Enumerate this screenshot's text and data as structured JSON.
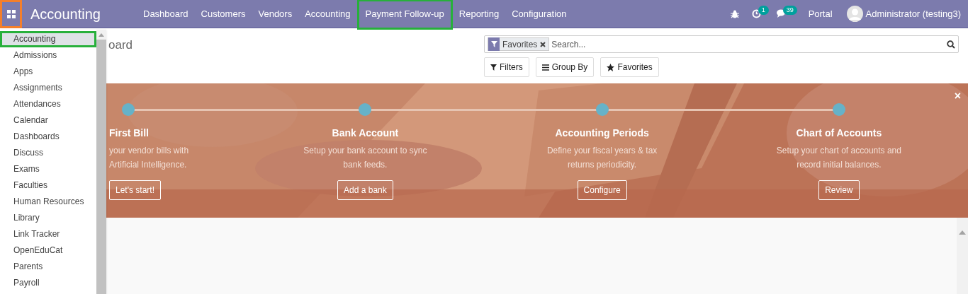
{
  "navbar": {
    "app_title": "Accounting",
    "menu": [
      {
        "label": "Dashboard",
        "highlighted": false
      },
      {
        "label": "Customers",
        "highlighted": false
      },
      {
        "label": "Vendors",
        "highlighted": false
      },
      {
        "label": "Accounting",
        "highlighted": false
      },
      {
        "label": "Payment Follow-up",
        "highlighted": true
      },
      {
        "label": "Reporting",
        "highlighted": false
      },
      {
        "label": "Configuration",
        "highlighted": false
      }
    ],
    "activity_count": "1",
    "message_count": "39",
    "portal": "Portal",
    "user": "Administrator (testing3)"
  },
  "breadcrumb": "oard",
  "search": {
    "facet": "Favorites",
    "placeholder": "Search..."
  },
  "search_buttons": [
    "Filters",
    "Group By",
    "Favorites"
  ],
  "banner": {
    "close": "×",
    "steps": [
      {
        "title": "First Bill",
        "description": "your vendor bills with Artificial Intelligence.",
        "button": "Let's start!",
        "clipped": true
      },
      {
        "title": "Bank Account",
        "description": "Setup your bank account to sync bank feeds.",
        "button": "Add a bank",
        "clipped": false
      },
      {
        "title": "Accounting Periods",
        "description": "Define your fiscal years & tax returns periodicity.",
        "button": "Configure",
        "clipped": false
      },
      {
        "title": "Chart of Accounts",
        "description": "Setup your chart of accounts and record initial balances.",
        "button": "Review",
        "clipped": false
      }
    ]
  },
  "apps_menu": [
    {
      "label": "Accounting",
      "highlighted": true
    },
    {
      "label": "Admissions",
      "highlighted": false
    },
    {
      "label": "Apps",
      "highlighted": false
    },
    {
      "label": "Assignments",
      "highlighted": false
    },
    {
      "label": "Attendances",
      "highlighted": false
    },
    {
      "label": "Calendar",
      "highlighted": false
    },
    {
      "label": "Dashboards",
      "highlighted": false
    },
    {
      "label": "Discuss",
      "highlighted": false
    },
    {
      "label": "Exams",
      "highlighted": false
    },
    {
      "label": "Faculties",
      "highlighted": false
    },
    {
      "label": "Human Resources",
      "highlighted": false
    },
    {
      "label": "Library",
      "highlighted": false
    },
    {
      "label": "Link Tracker",
      "highlighted": false
    },
    {
      "label": "OpenEduCat",
      "highlighted": false
    },
    {
      "label": "Parents",
      "highlighted": false
    },
    {
      "label": "Payroll",
      "highlighted": false
    }
  ]
}
